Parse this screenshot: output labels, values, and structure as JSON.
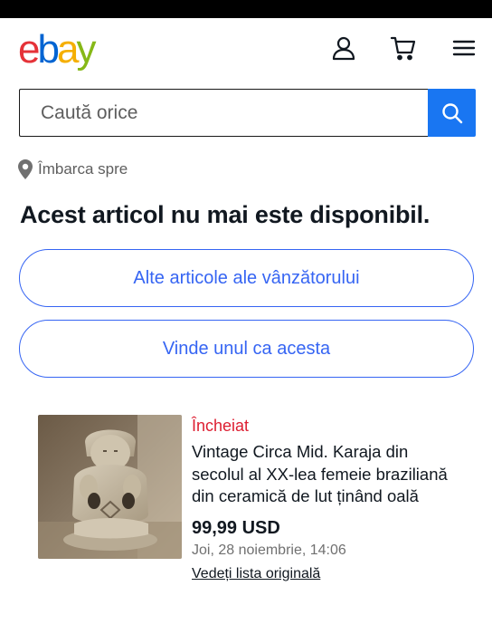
{
  "header": {
    "logo_letters": [
      {
        "char": "e",
        "color": "#e53238"
      },
      {
        "char": "b",
        "color": "#0064d2"
      },
      {
        "char": "a",
        "color": "#f5af02"
      },
      {
        "char": "y",
        "color": "#86b817"
      }
    ],
    "icons": [
      "user-icon",
      "cart-icon",
      "menu-icon"
    ]
  },
  "search": {
    "placeholder": "Caută orice",
    "button_icon": "search-icon",
    "accent": "#1976f2"
  },
  "shipping": {
    "icon": "location-pin-icon",
    "label": "Îmbarca spre"
  },
  "page": {
    "title": "Acest articol nu mai este disponibil."
  },
  "actions": {
    "seller_items": "Alte articole ale vânzătorului",
    "sell_similar": "Vinde unul ca acesta",
    "accent": "#3665f3"
  },
  "item": {
    "status": "Încheiat",
    "status_color": "#dd1e31",
    "title": "Vintage Circa Mid. Karaja din secolul al XX-lea femeie braziliană din ceramică de lut ținând oală",
    "price": "99,99 USD",
    "date": "Joi, 28 noiembrie, 14:06",
    "original_link": "Vedeți lista originală"
  }
}
